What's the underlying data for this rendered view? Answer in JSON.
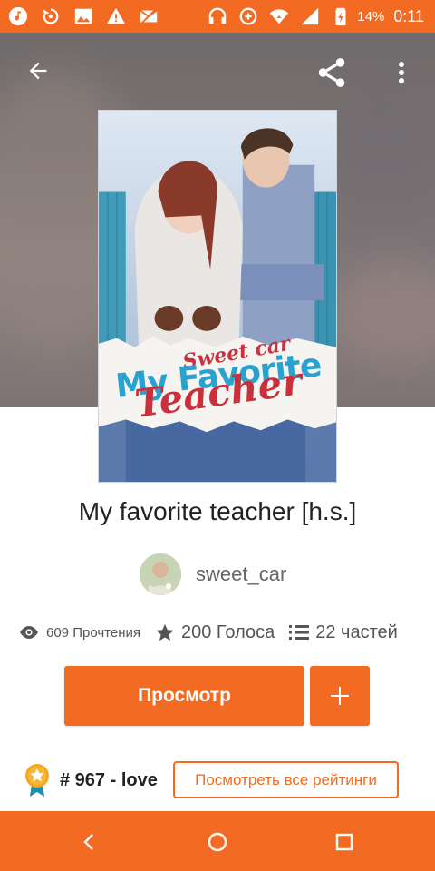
{
  "status_bar": {
    "battery_percent": "14%",
    "time": "0:11",
    "left_icons": [
      "music-note-icon",
      "sync-icon",
      "image-icon",
      "warning-icon",
      "mail-blocked-icon"
    ],
    "right_icons": [
      "headphones-icon",
      "data-saver-icon",
      "wifi-icon",
      "signal-icon",
      "battery-charging-icon"
    ]
  },
  "cover": {
    "title_line1": "My Favorite",
    "title_line2": "Teacher",
    "author_line": "Sweet car"
  },
  "story": {
    "title": "My favorite teacher [h.s.]",
    "author": "sweet_car"
  },
  "stats": {
    "reads": "609 Прочтения",
    "votes": "200 Голоса",
    "parts": "22 частей"
  },
  "actions": {
    "read_label": "Просмотр"
  },
  "ranking": {
    "rank_text": "# 967 - love",
    "all_ratings_label": "Посмотреть все рейтинги"
  },
  "colors": {
    "accent": "#f36b22",
    "text_primary": "#222222",
    "text_secondary": "#666666"
  }
}
